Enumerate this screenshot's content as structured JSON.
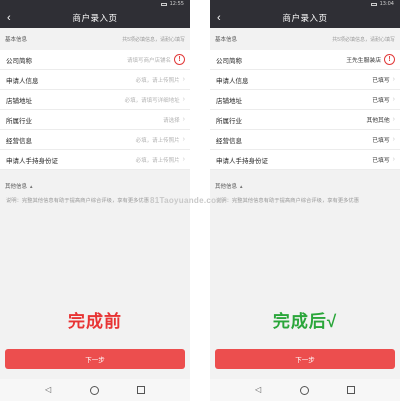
{
  "watermark": "81Taoyuande.com",
  "phones": [
    {
      "status_time": "12:55",
      "title": "商户录入页",
      "basic_info_label": "基本信息",
      "basic_info_hint": "共5项必填信息，请耐心填写",
      "rows": [
        {
          "name": "公司简称",
          "value": "请填写商户店铺名",
          "filled": false,
          "alert": true
        },
        {
          "name": "申请人信息",
          "value": "必填，请上传照片",
          "filled": false
        },
        {
          "name": "店铺地址",
          "value": "必填，请填写详细地址",
          "filled": false
        },
        {
          "name": "所属行业",
          "value": "请选择",
          "filled": false
        },
        {
          "name": "经营信息",
          "value": "必填，请上传照片",
          "filled": false
        },
        {
          "name": "申请人手持身份证",
          "value": "必填，请上传照片",
          "filled": false
        }
      ],
      "other_info_label": "其他信息",
      "note": "说明：完整其他信息有助于提高商户综合评级，享有更多优惠",
      "stamp": "完成前",
      "next_button": "下一步"
    },
    {
      "status_time": "13:04",
      "title": "商户录入页",
      "basic_info_label": "基本信息",
      "basic_info_hint": "共5项必填信息，请耐心填写",
      "rows": [
        {
          "name": "公司简称",
          "value": "王先生服装店",
          "filled": true,
          "alert": true
        },
        {
          "name": "申请人信息",
          "value": "已填写",
          "filled": true
        },
        {
          "name": "店铺地址",
          "value": "已填写",
          "filled": true
        },
        {
          "name": "所属行业",
          "value": "其他其他",
          "filled": true
        },
        {
          "name": "经营信息",
          "value": "已填写",
          "filled": true
        },
        {
          "name": "申请人手持身份证",
          "value": "已填写",
          "filled": true
        }
      ],
      "other_info_label": "其他信息",
      "note": "说明：完整其他信息有助于提高商户综合评级，享有更多优惠",
      "stamp": "完成后√",
      "next_button": "下一步"
    }
  ],
  "icons": {
    "back": "chevron-left-icon",
    "row_arrow": "chevron-right-icon",
    "alert": "exclamation-circle-icon",
    "nav_back": "triangle-back-icon",
    "nav_home": "circle-home-icon",
    "nav_recent": "square-recent-icon"
  },
  "colors": {
    "header_bg": "#2f2f35",
    "accent_red": "#ec4e4e",
    "stamp_before": "#e83434",
    "stamp_after": "#2aa63a"
  }
}
